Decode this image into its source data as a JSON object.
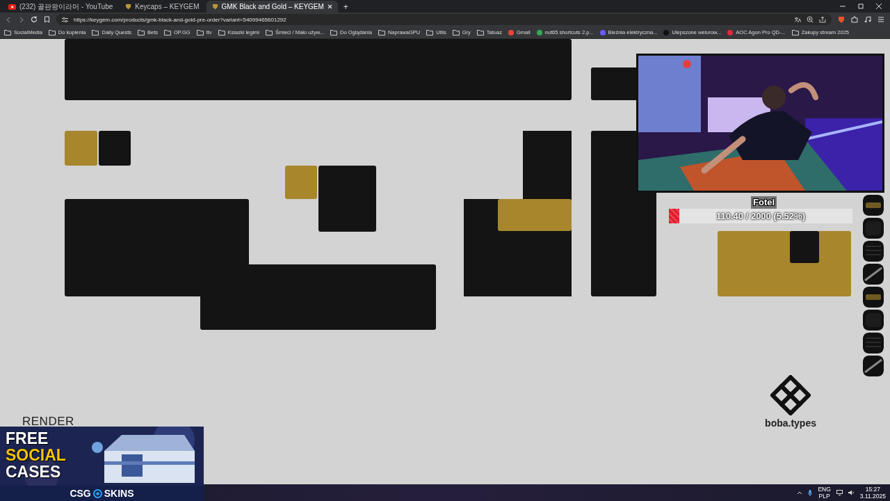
{
  "browser": {
    "tabs": [
      {
        "title": "(232) 골판왕이라머 - YouTube",
        "kind": "video",
        "selected": false
      },
      {
        "title": "Keycaps – KEYGEM",
        "kind": "shop",
        "selected": false
      },
      {
        "title": "GMK Black and Gold – KEYGEM",
        "kind": "shop",
        "selected": true
      }
    ],
    "new_tab": "+",
    "url": "https://keygem.com/products/gmk-black-and-gold-pre-order?variant=54099465601292",
    "bookmarks": [
      {
        "label": "SocialMedia",
        "kind": "folder"
      },
      {
        "label": "Do kupienia",
        "kind": "folder"
      },
      {
        "label": "Daily Quests",
        "kind": "folder"
      },
      {
        "label": "Bets",
        "kind": "folder"
      },
      {
        "label": "OP.GG",
        "kind": "folder"
      },
      {
        "label": "ttv",
        "kind": "folder"
      },
      {
        "label": "Ksiazki legimi",
        "kind": "folder"
      },
      {
        "label": "Śmieci / Mało używ...",
        "kind": "folder"
      },
      {
        "label": "Do Oglądania",
        "kind": "folder"
      },
      {
        "label": "NaprawaGPU",
        "kind": "folder"
      },
      {
        "label": "Utils",
        "kind": "folder"
      },
      {
        "label": "Gry",
        "kind": "folder"
      },
      {
        "label": "Tatuaz",
        "kind": "folder"
      },
      {
        "label": "Gmail",
        "kind": "link",
        "color": "#ea4335"
      },
      {
        "label": "nut65 shortcuts 2.p...",
        "kind": "link",
        "color": "#34a853"
      },
      {
        "label": "Bieżnia elektryczna...",
        "kind": "link",
        "color": "#6a5cff"
      },
      {
        "label": "Ulepszone welurow...",
        "kind": "link",
        "color": "#111111"
      },
      {
        "label": "AOC Agon Pro QD-...",
        "kind": "link",
        "color": "#e0283c"
      },
      {
        "label": "Zakupy stream 2025",
        "kind": "folder"
      }
    ]
  },
  "page": {
    "section_label": "RENDER",
    "brand": "boba.types"
  },
  "stream_overlay": {
    "goal": {
      "label": "Fotel",
      "level": 0.0552,
      "reading": "110.40 / 2000 (5.52%)"
    }
  },
  "ad": {
    "lines": [
      {
        "text": "FREE",
        "highlighted": false
      },
      {
        "text": "SOCIAL",
        "highlighted": true
      },
      {
        "text": "CASES",
        "highlighted": false
      }
    ],
    "brand_left": "CSG",
    "brand_right": "SKINS"
  },
  "taskbar": {
    "language": "ENG",
    "layout": "PLP",
    "time": "15:27",
    "date": "3.11.2025"
  }
}
